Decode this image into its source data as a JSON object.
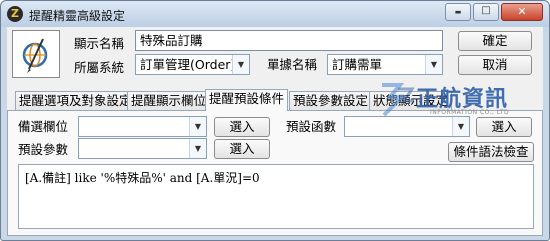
{
  "window": {
    "title": "提醒精靈高級設定",
    "app_icon_glyph": "Z",
    "minimize_glyph": "▬",
    "maximize_glyph": "□",
    "close_glyph": "✕"
  },
  "header": {
    "display_name_label": "顯示名稱",
    "display_name_value": "特殊品訂購",
    "system_label": "所屬系統",
    "system_value": "訂單管理(Order)",
    "form_name_label": "單據名稱",
    "form_name_value": "訂購需單",
    "confirm_button": "確定",
    "cancel_button": "取消"
  },
  "tabs": [
    {
      "label": "提醒選項及對象設定",
      "active": false
    },
    {
      "label": "提醒顯示欄位",
      "active": false
    },
    {
      "label": "提醒預設條件",
      "active": true
    },
    {
      "label": "預設參數設定",
      "active": false
    },
    {
      "label": "狀態顯示設定",
      "active": false
    }
  ],
  "conditions": {
    "field_label": "備選欄位",
    "field_value": "",
    "field_select_button": "選入",
    "function_label": "預設函數",
    "function_value": "",
    "function_select_button": "選入",
    "param_label": "預設參數",
    "param_value": "",
    "param_select_button": "選入",
    "syntax_check_button": "條件語法檢查",
    "expression": "[A.備註] like '%特殊品%' and [A.單況]=0"
  },
  "watermark": {
    "brand_text": "正航資訊",
    "sub_text": "INFORMATION CO., LTD"
  },
  "colors": {
    "title_bar": "#c9d7e6",
    "close_button": "#c8422b",
    "watermark_blue": "#2e5fa8"
  },
  "icons": {
    "app": "app-logo-icon",
    "form": "globe-pen-icon",
    "dropdown": "chevron-down-icon"
  }
}
